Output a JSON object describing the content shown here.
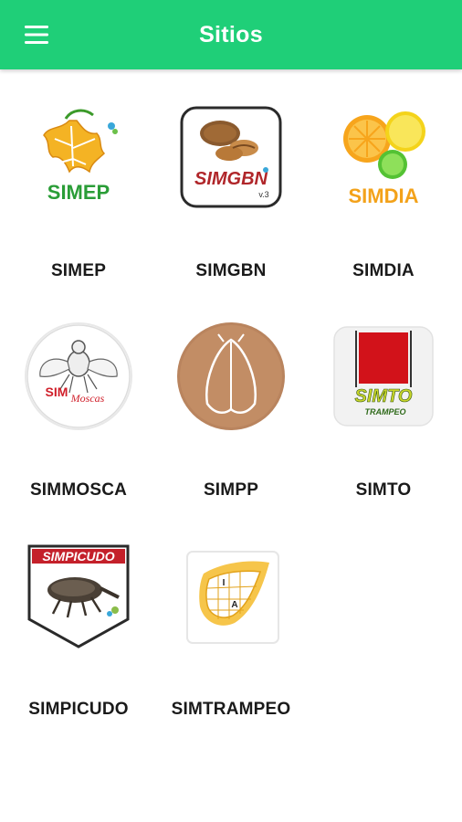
{
  "appbar": {
    "title": "Sitios",
    "menu_icon": "hamburger-menu-icon",
    "background": "#1fcf78"
  },
  "sites": [
    {
      "label": "SIMEP",
      "logo_text": "SIMEP",
      "icon": "ivy-leaf-logo-icon"
    },
    {
      "label": "SIMGBN",
      "logo_text": "SIMGBN",
      "logo_subtext": "v.3",
      "icon": "pecan-nut-logo-icon"
    },
    {
      "label": "SIMDIA",
      "logo_text": "SIMDIA",
      "icon": "citrus-fruit-logo-icon"
    },
    {
      "label": "SIMMOSCA",
      "logo_text": "SIM",
      "logo_subtext": "Moscas",
      "icon": "fly-logo-icon"
    },
    {
      "label": "SIMPP",
      "icon": "moth-logo-icon"
    },
    {
      "label": "SIMTO",
      "logo_text": "SIMTO",
      "logo_subtext": "TRAMPEO",
      "icon": "trap-logo-icon"
    },
    {
      "label": "SIMPICUDO",
      "logo_text": "SIMPICUDO",
      "icon": "weevil-logo-icon"
    },
    {
      "label": "SIMTRAMPEO",
      "logo_text_a": "I",
      "logo_text_b": "A",
      "icon": "trap-grid-logo-icon"
    }
  ]
}
